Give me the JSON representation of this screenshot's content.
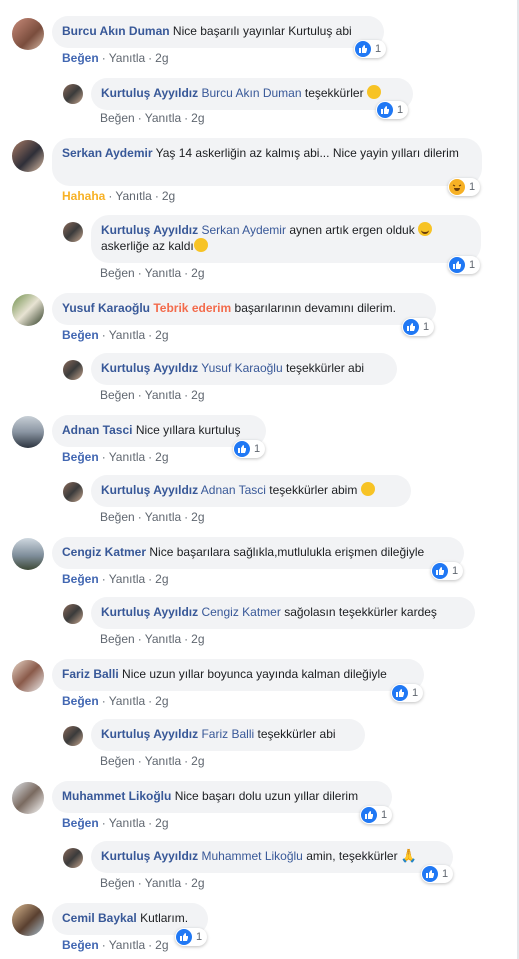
{
  "labels": {
    "like": "Beğen",
    "reply": "Yanıtla",
    "time": "2g",
    "haha": "Hahaha"
  },
  "colors": {
    "name": "#385898",
    "like_blue": "#2078f4",
    "haha_yellow": "#f7b125",
    "highlight": "#f36b4c"
  },
  "comments": [
    {
      "name": "Burcu Akın Duman",
      "text": "Nice başarılı yayınlar Kurtuluş abi",
      "reactions": "1",
      "reply": {
        "name": "Kurtuluş Ayyıldız",
        "tag": "Burcu Akın Duman",
        "text": "teşekkürler",
        "reactions": "1"
      }
    },
    {
      "name": "Serkan Aydemir",
      "text": "Yaş 14 askerliğin az kalmış abi... Nice yayin yılları dilerim",
      "reactions": "1",
      "reply": {
        "name": "Kurtuluş Ayyıldız",
        "tag": "Serkan Aydemir",
        "text1": "aynen artık ergen olduk",
        "text2": "askerliğe az kaldı",
        "reactions": "1"
      }
    },
    {
      "name": "Yusuf Karaoğlu",
      "highlight": "Tebrik ederim",
      "text": "başarılarının devamını dilerim.",
      "reactions": "1",
      "reply": {
        "name": "Kurtuluş Ayyıldız",
        "tag": "Yusuf Karaoğlu",
        "text": "teşekkürler abi"
      }
    },
    {
      "name": "Adnan Tasci",
      "text": "Nice yıllara kurtuluş",
      "reactions": "1",
      "reply": {
        "name": "Kurtuluş Ayyıldız",
        "tag": "Adnan Tasci",
        "text": "teşekkürler abim"
      }
    },
    {
      "name": "Cengiz Katmer",
      "text": "Nice başarılara sağlıkla,mutlulukla erişmen dileğiyle",
      "reactions": "1",
      "reply": {
        "name": "Kurtuluş Ayyıldız",
        "tag": "Cengiz Katmer",
        "text": "sağolasın teşekkürler kardeş"
      }
    },
    {
      "name": "Fariz Balli",
      "text": "Nice uzun yıllar boyunca yayında kalman dileğiyle",
      "reactions": "1",
      "reply": {
        "name": "Kurtuluş Ayyıldız",
        "tag": "Fariz Balli",
        "text": "teşekkürler abi"
      }
    },
    {
      "name": "Muhammet Likoğlu",
      "text": "Nice başarı dolu uzun yıllar dilerim",
      "reactions": "1",
      "reply": {
        "name": "Kurtuluş Ayyıldız",
        "tag": "Muhammet Likoğlu",
        "text": "amin, teşekkürler",
        "reactions": "1"
      }
    },
    {
      "name": "Cemil Baykal",
      "text": "Kutlarım.",
      "reactions": "1"
    }
  ]
}
